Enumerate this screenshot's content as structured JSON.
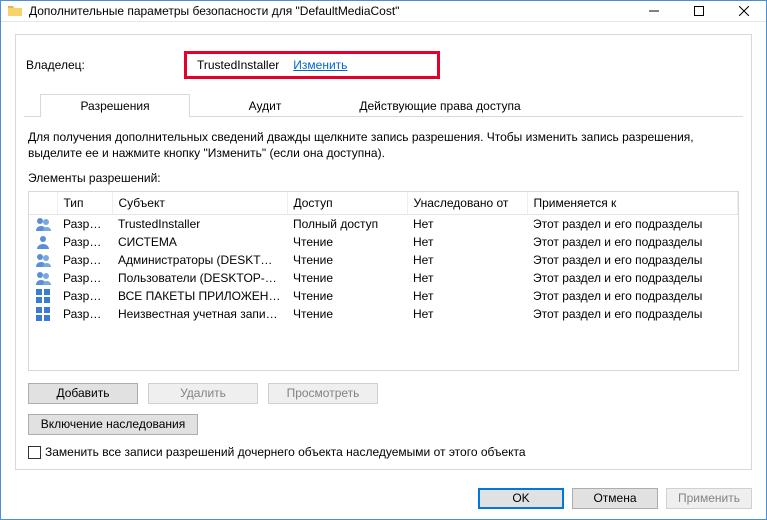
{
  "title": "Дополнительные параметры безопасности для \"DefaultMediaCost\"",
  "owner": {
    "label": "Владелец:",
    "value": "TrustedInstaller",
    "change": "Изменить"
  },
  "tabs": {
    "permissions": "Разрешения",
    "audit": "Аудит",
    "effective": "Действующие права доступа"
  },
  "instruction": "Для получения дополнительных сведений дважды щелкните запись разрешения. Чтобы изменить запись разрешения, выделите ее и нажмите кнопку \"Изменить\" (если она доступна).",
  "elements_label": "Элементы разрешений:",
  "columns": {
    "type": "Тип",
    "subject": "Субъект",
    "access": "Доступ",
    "inherited": "Унаследовано от",
    "applies": "Применяется к"
  },
  "rows": [
    {
      "icon": "users",
      "type": "Разр…",
      "subject": "TrustedInstaller",
      "access": "Полный доступ",
      "inherited": "Нет",
      "applies": "Этот раздел и его подразделы"
    },
    {
      "icon": "user",
      "type": "Разр…",
      "subject": "СИСТЕМА",
      "access": "Чтение",
      "inherited": "Нет",
      "applies": "Этот раздел и его подразделы"
    },
    {
      "icon": "users",
      "type": "Разр…",
      "subject": "Администраторы (DESKTOP-…",
      "access": "Чтение",
      "inherited": "Нет",
      "applies": "Этот раздел и его подразделы"
    },
    {
      "icon": "users",
      "type": "Разр…",
      "subject": "Пользователи (DESKTOP-VN…",
      "access": "Чтение",
      "inherited": "Нет",
      "applies": "Этот раздел и его подразделы"
    },
    {
      "icon": "pkg",
      "type": "Разр…",
      "subject": "ВСЕ ПАКЕТЫ ПРИЛОЖЕНИЙ",
      "access": "Чтение",
      "inherited": "Нет",
      "applies": "Этот раздел и его подразделы"
    },
    {
      "icon": "pkg",
      "type": "Разр…",
      "subject": "Неизвестная учетная запис…",
      "access": "Чтение",
      "inherited": "Нет",
      "applies": "Этот раздел и его подразделы"
    }
  ],
  "buttons": {
    "add": "Добавить",
    "remove": "Удалить",
    "view": "Просмотреть",
    "inherit": "Включение наследования",
    "replace_label": "Заменить все записи разрешений дочернего объекта наследуемыми от этого объекта",
    "ok": "OK",
    "cancel": "Отмена",
    "apply": "Применить"
  }
}
